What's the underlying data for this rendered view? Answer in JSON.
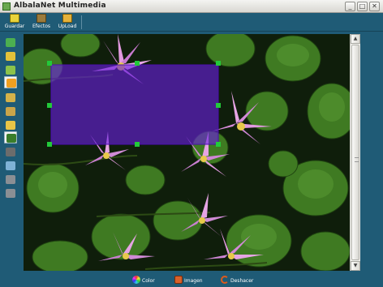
{
  "window": {
    "title": "AlbalaNet Multimedia",
    "controls": {
      "minimize": "_",
      "maximize": "□",
      "close": "✕"
    }
  },
  "toolbar": {
    "buttons": [
      {
        "label": "Guardar",
        "icon": "save-icon"
      },
      {
        "label": "Efectos",
        "icon": "effects-icon"
      },
      {
        "label": "UpLoad",
        "icon": "upload-icon"
      }
    ]
  },
  "tools": [
    {
      "icon": "flag-tool-icon",
      "color": "#4caf50"
    },
    {
      "icon": "people-tool-icon",
      "color": "#e2c23a"
    },
    {
      "icon": "group-tool-icon",
      "color": "#8bc34a"
    },
    {
      "icon": "pencil-tool-icon",
      "color": "#f0a020",
      "active": true
    },
    {
      "icon": "person-tool-icon",
      "color": "#d4b24a"
    },
    {
      "icon": "frame-tool-icon",
      "color": "#c9a54a"
    },
    {
      "icon": "users-tool-icon",
      "color": "#e8c547"
    },
    {
      "icon": "crop-tool-icon",
      "color": "#3a7d2a",
      "active": true
    },
    {
      "icon": "text-tool-icon",
      "color": "#6c6c6c"
    },
    {
      "icon": "zoom-tool-icon",
      "color": "#7fb2d6"
    },
    {
      "icon": "shape-tool-icon",
      "color": "#8a8f94"
    },
    {
      "icon": "stamp-tool-icon",
      "color": "#8a8f94"
    }
  ],
  "canvas": {
    "image": "water-lilies-photo",
    "selection_color": "#6a1fe0"
  },
  "scrollbar": {
    "up": "▲",
    "down": "▼"
  },
  "bottombar": {
    "buttons": [
      {
        "label": "Color",
        "icon": "color-wheel-icon"
      },
      {
        "label": "Imagen",
        "icon": "image-icon"
      },
      {
        "label": "Deshacer",
        "icon": "undo-icon"
      }
    ]
  }
}
